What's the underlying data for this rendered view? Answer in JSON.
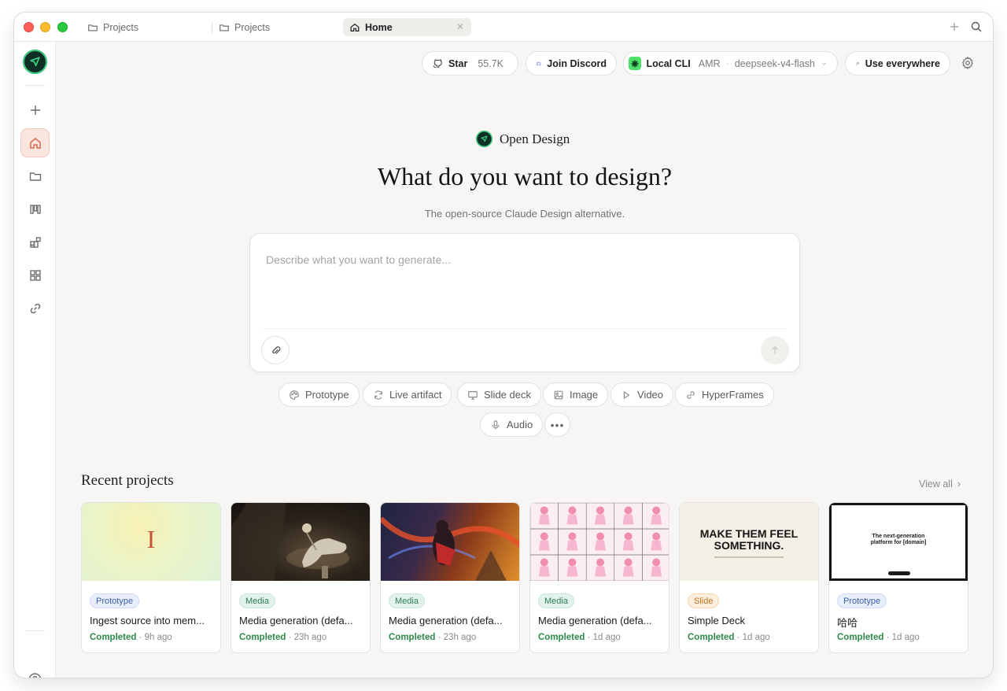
{
  "tabs": [
    {
      "label": "Projects",
      "icon": "folder-icon"
    },
    {
      "label": "Projects",
      "icon": "folder-icon"
    },
    {
      "label": "Home",
      "icon": "home-icon",
      "active": true
    }
  ],
  "topbar": {
    "star_label": "Star",
    "star_count": "55.7K",
    "discord_label": "Join Discord",
    "cli_label": "Local CLI",
    "cli_provider": "AMR",
    "cli_model": "deepseek-v4-flash",
    "use_everywhere_label": "Use everywhere"
  },
  "hero": {
    "brand": "Open Design",
    "headline": "What do you want to design?",
    "subline": "The open-source Claude Design alternative.",
    "prompt_placeholder": "Describe what you want to generate..."
  },
  "chips": [
    {
      "label": "Prototype",
      "icon": "palette-icon"
    },
    {
      "label": "Live artifact",
      "icon": "refresh-icon"
    },
    {
      "label": "Slide deck",
      "icon": "monitor-icon"
    },
    {
      "label": "Image",
      "icon": "image-icon"
    },
    {
      "label": "Video",
      "icon": "play-icon"
    },
    {
      "label": "HyperFrames",
      "icon": "link-icon"
    },
    {
      "label": "Audio",
      "icon": "mic-icon"
    }
  ],
  "recent": {
    "title": "Recent projects",
    "view_all": "View all",
    "status_completed": "Completed",
    "cards": [
      {
        "badge": "Prototype",
        "title": "Ingest source into mem...",
        "time": "9h ago",
        "thumb_letter": "I"
      },
      {
        "badge": "Media",
        "title": "Media generation (defa...",
        "time": "23h ago"
      },
      {
        "badge": "Media",
        "title": "Media generation (defa...",
        "time": "23h ago"
      },
      {
        "badge": "Media",
        "title": "Media generation (defa...",
        "time": "1d ago"
      },
      {
        "badge": "Slide",
        "title": "Simple Deck",
        "time": "1d ago",
        "thumb_text": "MAKE THEM FEEL SOMETHING."
      },
      {
        "badge": "Prototype",
        "title": "哈哈",
        "time": "1d ago",
        "thumb_text": "The next-generation platform for [domain]"
      }
    ]
  },
  "colors": {
    "accent": "#d86a52",
    "brand_dark": "#0f2e26",
    "brand_green": "#3fcf82",
    "completed": "#2e8a4a"
  }
}
